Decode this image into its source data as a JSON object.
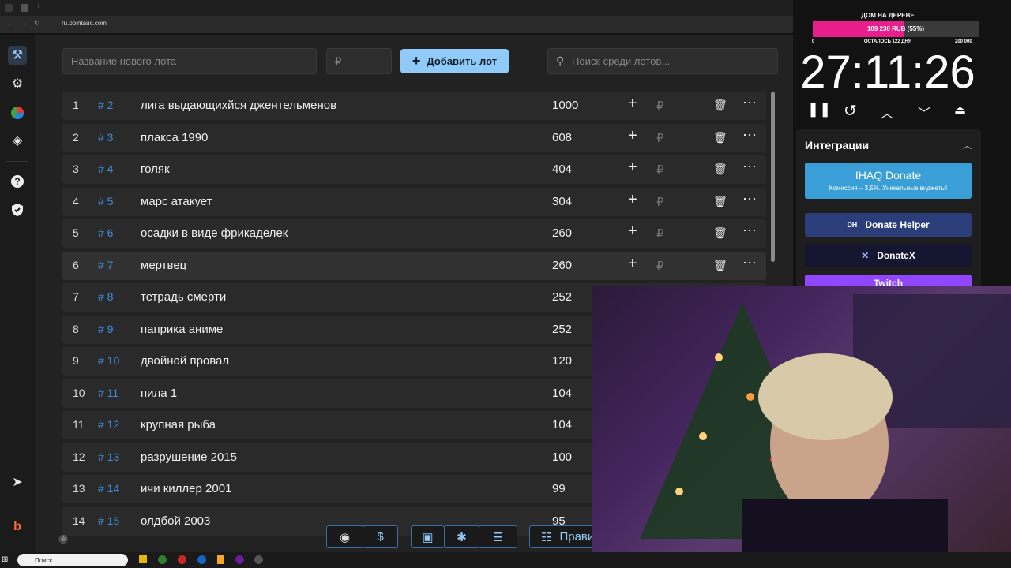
{
  "browser": {
    "url": "ru.pointauc.com"
  },
  "overlay": {
    "title": "ДОМ НА ДЕРЕВЕ",
    "progress_text": "109 230 RUB (55%)",
    "progress": 0.55,
    "min": "0",
    "remaining": "ОСТАЛОСЬ 122 ДНЯ",
    "max": "200 000"
  },
  "timer": "27:11:26",
  "integrations": {
    "title": "Интеграции",
    "ihaq_title": "IHAQ Donate",
    "ihaq_sub": "Комиссия – 3,5%. Уникальные виджеты!",
    "donate_helper": "Donate Helper",
    "donatex": "DonateX",
    "twitch": "Twitch"
  },
  "toolbar": {
    "name_placeholder": "Название нового лота",
    "price_placeholder": "₽",
    "add_label": "Добавить лот",
    "search_placeholder": "Поиск среди лотов..."
  },
  "bottom": {
    "rules_label": "Правил"
  },
  "taskbar": {
    "search": "Поиск"
  },
  "lots": [
    {
      "idx": "1",
      "id": "# 2",
      "name": "лига выдающихйся джентельменов",
      "amount": "1000"
    },
    {
      "idx": "2",
      "id": "# 3",
      "name": "плакса 1990",
      "amount": "608"
    },
    {
      "idx": "3",
      "id": "# 4",
      "name": "голяк",
      "amount": "404"
    },
    {
      "idx": "4",
      "id": "# 5",
      "name": "марс атакует",
      "amount": "304"
    },
    {
      "idx": "5",
      "id": "# 6",
      "name": "осадки в виде фрикаделек",
      "amount": "260"
    },
    {
      "idx": "6",
      "id": "# 7",
      "name": "мертвец",
      "amount": "260"
    },
    {
      "idx": "7",
      "id": "# 8",
      "name": "тетрадь смерти",
      "amount": "252"
    },
    {
      "idx": "8",
      "id": "# 9",
      "name": "паприка аниме",
      "amount": "252"
    },
    {
      "idx": "9",
      "id": "# 10",
      "name": " двойной провал",
      "amount": "120"
    },
    {
      "idx": "10",
      "id": "# 11",
      "name": "пила 1",
      "amount": "104"
    },
    {
      "idx": "11",
      "id": "# 12",
      "name": "крупная рыба",
      "amount": "104"
    },
    {
      "idx": "12",
      "id": "# 13",
      "name": "разрушение 2015",
      "amount": "100"
    },
    {
      "idx": "13",
      "id": "# 14",
      "name": "ичи киллер 2001",
      "amount": "99"
    },
    {
      "idx": "14",
      "id": "# 15",
      "name": "олдбой 2003",
      "amount": "95"
    }
  ],
  "colors": {
    "accent": "#90caf9",
    "id_blue": "#3f8fe0",
    "progress_pink": "#e91e8c",
    "ihaq": "#3a9fd6",
    "donate_helper": "#2c3e7a",
    "donatex": "#161630",
    "twitch": "#9146ff"
  }
}
